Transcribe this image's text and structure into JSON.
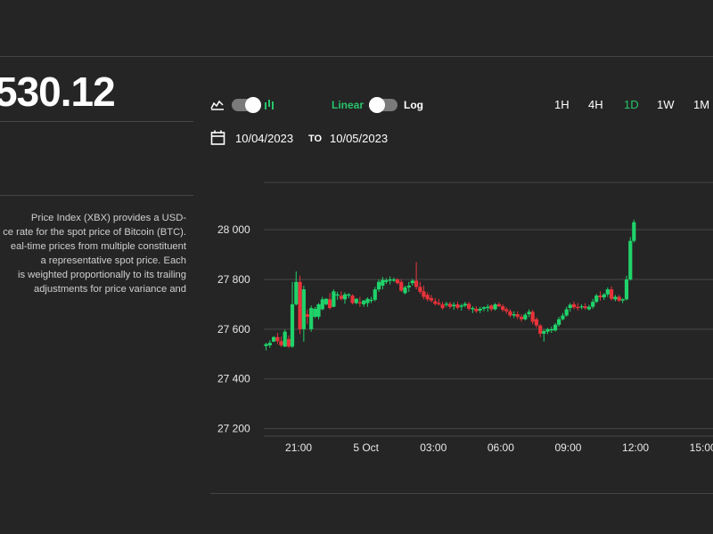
{
  "header": {
    "price": "530.12"
  },
  "description": {
    "lines": [
      "Price Index (XBX) provides a USD-",
      "ce rate for the spot price of Bitcoin (BTC).",
      "eal-time prices from multiple constituent",
      "a representative spot price. Each",
      "is weighted proportionally to its trailing",
      "adjustments for price variance and"
    ]
  },
  "controls": {
    "chart_style_toggle": {
      "left_icon": "area-chart-icon",
      "right_icon": "candlestick-icon"
    },
    "scale_linear_label": "Linear",
    "scale_log_label": "Log",
    "ranges": [
      {
        "label": "1H",
        "active": false
      },
      {
        "label": "4H",
        "active": false
      },
      {
        "label": "1D",
        "active": true
      },
      {
        "label": "1W",
        "active": false
      },
      {
        "label": "1M",
        "active": false
      }
    ]
  },
  "date_range": {
    "icon": "calendar-icon",
    "from": "10/04/2023",
    "to_label": "TO",
    "to": "10/05/2023"
  },
  "colors": {
    "up": "#1fd36a",
    "down": "#e8333a",
    "grid": "#474747",
    "accent": "#27c46b",
    "background": "#252525"
  },
  "chart_data": {
    "type": "candlestick",
    "y_ticks": [
      {
        "value": 27200,
        "label": "27 200"
      },
      {
        "value": 27400,
        "label": "27 400"
      },
      {
        "value": 27600,
        "label": "27 600"
      },
      {
        "value": 27800,
        "label": "27 800"
      },
      {
        "value": 28000,
        "label": "28 000"
      }
    ],
    "x_ticks": [
      {
        "hour": 21,
        "label": "21:00"
      },
      {
        "hour": 24,
        "label": "5 Oct"
      },
      {
        "hour": 27,
        "label": "03:00"
      },
      {
        "hour": 30,
        "label": "06:00"
      },
      {
        "hour": 33,
        "label": "09:00"
      },
      {
        "hour": 36,
        "label": "12:00"
      },
      {
        "hour": 39,
        "label": "15:00"
      }
    ],
    "ylim": [
      27170,
      28190
    ],
    "xlim": [
      19.45,
      39.45
    ],
    "grid": true,
    "candles": [
      {
        "hour": 19.55,
        "open": 27532,
        "high": 27545,
        "low": 27515,
        "close": 27540
      },
      {
        "hour": 19.72,
        "open": 27535,
        "high": 27555,
        "low": 27525,
        "close": 27545
      },
      {
        "hour": 19.89,
        "open": 27550,
        "high": 27572,
        "low": 27548,
        "close": 27568
      },
      {
        "hour": 20.06,
        "open": 27568,
        "high": 27585,
        "low": 27540,
        "close": 27552
      },
      {
        "hour": 20.22,
        "open": 27552,
        "high": 27570,
        "low": 27528,
        "close": 27535
      },
      {
        "hour": 20.39,
        "open": 27530,
        "high": 27598,
        "low": 27528,
        "close": 27590
      },
      {
        "hour": 20.56,
        "open": 27560,
        "high": 27575,
        "low": 27525,
        "close": 27530
      },
      {
        "hour": 20.72,
        "open": 27530,
        "high": 27790,
        "low": 27525,
        "close": 27700
      },
      {
        "hour": 20.89,
        "open": 27700,
        "high": 27832,
        "low": 27695,
        "close": 27790
      },
      {
        "hour": 21.06,
        "open": 27790,
        "high": 27815,
        "low": 27580,
        "close": 27600
      },
      {
        "hour": 21.23,
        "open": 27600,
        "high": 27775,
        "low": 27550,
        "close": 27760
      },
      {
        "hour": 21.39,
        "open": 27660,
        "high": 27680,
        "low": 27620,
        "close": 27650
      },
      {
        "hour": 21.56,
        "open": 27600,
        "high": 27695,
        "low": 27590,
        "close": 27685
      },
      {
        "hour": 21.73,
        "open": 27650,
        "high": 27690,
        "low": 27645,
        "close": 27682
      },
      {
        "hour": 21.89,
        "open": 27650,
        "high": 27705,
        "low": 27640,
        "close": 27700
      },
      {
        "hour": 22.06,
        "open": 27680,
        "high": 27730,
        "low": 27676,
        "close": 27720
      },
      {
        "hour": 22.23,
        "open": 27700,
        "high": 27725,
        "low": 27695,
        "close": 27722
      },
      {
        "hour": 22.39,
        "open": 27720,
        "high": 27745,
        "low": 27680,
        "close": 27685
      },
      {
        "hour": 22.56,
        "open": 27690,
        "high": 27760,
        "low": 27688,
        "close": 27752
      },
      {
        "hour": 22.73,
        "open": 27735,
        "high": 27750,
        "low": 27718,
        "close": 27740
      },
      {
        "hour": 22.9,
        "open": 27735,
        "high": 27752,
        "low": 27715,
        "close": 27722
      },
      {
        "hour": 23.06,
        "open": 27720,
        "high": 27748,
        "low": 27702,
        "close": 27740
      },
      {
        "hour": 23.23,
        "open": 27735,
        "high": 27745,
        "low": 27725,
        "close": 27740
      },
      {
        "hour": 23.4,
        "open": 27735,
        "high": 27740,
        "low": 27700,
        "close": 27705
      },
      {
        "hour": 23.57,
        "open": 27705,
        "high": 27725,
        "low": 27700,
        "close": 27722
      },
      {
        "hour": 23.73,
        "open": 27708,
        "high": 27730,
        "low": 27690,
        "close": 27705
      },
      {
        "hour": 23.9,
        "open": 27700,
        "high": 27718,
        "low": 27690,
        "close": 27715
      },
      {
        "hour": 24.07,
        "open": 27705,
        "high": 27728,
        "low": 27690,
        "close": 27722
      },
      {
        "hour": 24.23,
        "open": 27715,
        "high": 27730,
        "low": 27705,
        "close": 27718
      },
      {
        "hour": 24.4,
        "open": 27718,
        "high": 27770,
        "low": 27712,
        "close": 27760
      },
      {
        "hour": 24.57,
        "open": 27760,
        "high": 27800,
        "low": 27750,
        "close": 27790
      },
      {
        "hour": 24.74,
        "open": 27775,
        "high": 27810,
        "low": 27760,
        "close": 27798
      },
      {
        "hour": 24.9,
        "open": 27790,
        "high": 27805,
        "low": 27782,
        "close": 27797
      },
      {
        "hour": 25.07,
        "open": 27795,
        "high": 27812,
        "low": 27780,
        "close": 27800
      },
      {
        "hour": 25.24,
        "open": 27795,
        "high": 27808,
        "low": 27790,
        "close": 27800
      },
      {
        "hour": 25.4,
        "open": 27800,
        "high": 27805,
        "low": 27780,
        "close": 27785
      },
      {
        "hour": 25.57,
        "open": 27790,
        "high": 27800,
        "low": 27750,
        "close": 27755
      },
      {
        "hour": 25.74,
        "open": 27745,
        "high": 27775,
        "low": 27740,
        "close": 27768
      },
      {
        "hour": 25.91,
        "open": 27768,
        "high": 27790,
        "low": 27750,
        "close": 27775
      },
      {
        "hour": 26.07,
        "open": 27785,
        "high": 27802,
        "low": 27775,
        "close": 27795
      },
      {
        "hour": 26.24,
        "open": 27795,
        "high": 27870,
        "low": 27760,
        "close": 27770
      },
      {
        "hour": 26.41,
        "open": 27770,
        "high": 27790,
        "low": 27742,
        "close": 27750
      },
      {
        "hour": 26.57,
        "open": 27752,
        "high": 27775,
        "low": 27720,
        "close": 27730
      },
      {
        "hour": 26.74,
        "open": 27738,
        "high": 27748,
        "low": 27712,
        "close": 27720
      },
      {
        "hour": 26.91,
        "open": 27725,
        "high": 27738,
        "low": 27708,
        "close": 27715
      },
      {
        "hour": 27.08,
        "open": 27712,
        "high": 27725,
        "low": 27695,
        "close": 27702
      },
      {
        "hour": 27.24,
        "open": 27705,
        "high": 27722,
        "low": 27695,
        "close": 27700
      },
      {
        "hour": 27.41,
        "open": 27700,
        "high": 27710,
        "low": 27678,
        "close": 27685
      },
      {
        "hour": 27.58,
        "open": 27700,
        "high": 27710,
        "low": 27690,
        "close": 27702
      },
      {
        "hour": 27.74,
        "open": 27702,
        "high": 27710,
        "low": 27682,
        "close": 27690
      },
      {
        "hour": 27.91,
        "open": 27692,
        "high": 27708,
        "low": 27678,
        "close": 27698
      },
      {
        "hour": 28.08,
        "open": 27700,
        "high": 27710,
        "low": 27680,
        "close": 27686
      },
      {
        "hour": 28.25,
        "open": 27690,
        "high": 27702,
        "low": 27675,
        "close": 27695
      },
      {
        "hour": 28.41,
        "open": 27695,
        "high": 27710,
        "low": 27688,
        "close": 27702
      },
      {
        "hour": 28.58,
        "open": 27702,
        "high": 27710,
        "low": 27675,
        "close": 27682
      },
      {
        "hour": 28.75,
        "open": 27680,
        "high": 27692,
        "low": 27665,
        "close": 27685
      },
      {
        "hour": 28.91,
        "open": 27682,
        "high": 27692,
        "low": 27665,
        "close": 27672
      },
      {
        "hour": 29.08,
        "open": 27675,
        "high": 27690,
        "low": 27665,
        "close": 27682
      },
      {
        "hour": 29.25,
        "open": 27682,
        "high": 27692,
        "low": 27672,
        "close": 27688
      },
      {
        "hour": 29.42,
        "open": 27685,
        "high": 27700,
        "low": 27670,
        "close": 27690
      },
      {
        "hour": 29.58,
        "open": 27695,
        "high": 27700,
        "low": 27672,
        "close": 27680
      },
      {
        "hour": 29.75,
        "open": 27680,
        "high": 27705,
        "low": 27675,
        "close": 27700
      },
      {
        "hour": 29.92,
        "open": 27700,
        "high": 27708,
        "low": 27688,
        "close": 27692
      },
      {
        "hour": 30.09,
        "open": 27692,
        "high": 27700,
        "low": 27670,
        "close": 27678
      },
      {
        "hour": 30.25,
        "open": 27680,
        "high": 27688,
        "low": 27662,
        "close": 27672
      },
      {
        "hour": 30.42,
        "open": 27672,
        "high": 27680,
        "low": 27648,
        "close": 27655
      },
      {
        "hour": 30.59,
        "open": 27655,
        "high": 27672,
        "low": 27645,
        "close": 27660
      },
      {
        "hour": 30.75,
        "open": 27660,
        "high": 27672,
        "low": 27640,
        "close": 27650
      },
      {
        "hour": 30.92,
        "open": 27650,
        "high": 27660,
        "low": 27630,
        "close": 27640
      },
      {
        "hour": 31.09,
        "open": 27640,
        "high": 27665,
        "low": 27635,
        "close": 27658
      },
      {
        "hour": 31.26,
        "open": 27660,
        "high": 27680,
        "low": 27648,
        "close": 27670
      },
      {
        "hour": 31.42,
        "open": 27670,
        "high": 27678,
        "low": 27620,
        "close": 27630
      },
      {
        "hour": 31.59,
        "open": 27640,
        "high": 27648,
        "low": 27605,
        "close": 27615
      },
      {
        "hour": 31.76,
        "open": 27615,
        "high": 27620,
        "low": 27568,
        "close": 27582
      },
      {
        "hour": 31.92,
        "open": 27582,
        "high": 27600,
        "low": 27550,
        "close": 27592
      },
      {
        "hour": 32.09,
        "open": 27590,
        "high": 27605,
        "low": 27580,
        "close": 27600
      },
      {
        "hour": 32.26,
        "open": 27595,
        "high": 27610,
        "low": 27585,
        "close": 27600
      },
      {
        "hour": 32.43,
        "open": 27595,
        "high": 27625,
        "low": 27590,
        "close": 27618
      },
      {
        "hour": 32.59,
        "open": 27618,
        "high": 27650,
        "low": 27610,
        "close": 27640
      },
      {
        "hour": 32.76,
        "open": 27640,
        "high": 27665,
        "low": 27635,
        "close": 27655
      },
      {
        "hour": 32.93,
        "open": 27655,
        "high": 27690,
        "low": 27650,
        "close": 27680
      },
      {
        "hour": 33.09,
        "open": 27685,
        "high": 27705,
        "low": 27670,
        "close": 27698
      },
      {
        "hour": 33.26,
        "open": 27700,
        "high": 27712,
        "low": 27680,
        "close": 27688
      },
      {
        "hour": 33.43,
        "open": 27690,
        "high": 27705,
        "low": 27675,
        "close": 27685
      },
      {
        "hour": 33.6,
        "open": 27688,
        "high": 27700,
        "low": 27680,
        "close": 27692
      },
      {
        "hour": 33.76,
        "open": 27692,
        "high": 27705,
        "low": 27678,
        "close": 27685
      },
      {
        "hour": 33.93,
        "open": 27680,
        "high": 27698,
        "low": 27675,
        "close": 27690
      },
      {
        "hour": 34.1,
        "open": 27690,
        "high": 27722,
        "low": 27682,
        "close": 27710
      },
      {
        "hour": 34.26,
        "open": 27710,
        "high": 27742,
        "low": 27705,
        "close": 27735
      },
      {
        "hour": 34.43,
        "open": 27735,
        "high": 27752,
        "low": 27715,
        "close": 27728
      },
      {
        "hour": 34.6,
        "open": 27728,
        "high": 27745,
        "low": 27718,
        "close": 27740
      },
      {
        "hour": 34.76,
        "open": 27740,
        "high": 27768,
        "low": 27730,
        "close": 27760
      },
      {
        "hour": 34.93,
        "open": 27760,
        "high": 27772,
        "low": 27715,
        "close": 27722
      },
      {
        "hour": 35.1,
        "open": 27720,
        "high": 27738,
        "low": 27712,
        "close": 27730
      },
      {
        "hour": 35.27,
        "open": 27730,
        "high": 27738,
        "low": 27710,
        "close": 27715
      },
      {
        "hour": 35.43,
        "open": 27715,
        "high": 27725,
        "low": 27705,
        "close": 27720
      },
      {
        "hour": 35.6,
        "open": 27720,
        "high": 27815,
        "low": 27715,
        "close": 27800
      },
      {
        "hour": 35.77,
        "open": 27800,
        "high": 27970,
        "low": 27795,
        "close": 27955
      },
      {
        "hour": 35.93,
        "open": 27955,
        "high": 28040,
        "low": 27948,
        "close": 28030
      }
    ]
  }
}
